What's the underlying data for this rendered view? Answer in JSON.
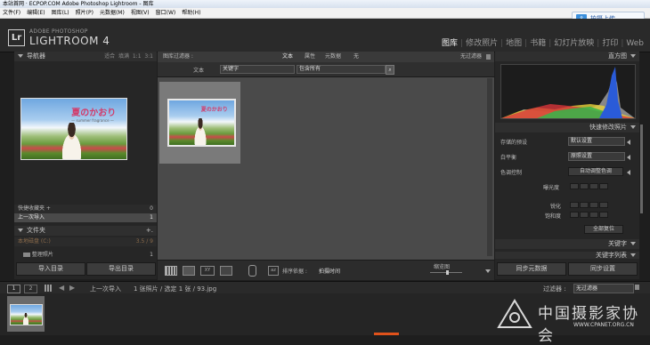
{
  "window": {
    "title_prefix": "本站首网 · ECPOP.COM",
    "title": "Adobe Photoshop Lightroom - 图库"
  },
  "menu": [
    "文件(F)",
    "编辑(E)",
    "图库(L)",
    "照片(P)",
    "元数据(M)",
    "视图(V)",
    "窗口(W)",
    "帮助(H)"
  ],
  "upload_button": {
    "label": "拍摄上传"
  },
  "identity": {
    "logo": "Lr",
    "small": "ADOBE PHOTOSHOP",
    "big": "LIGHTROOM 4"
  },
  "modules": [
    {
      "label": "图库",
      "active": true
    },
    {
      "label": "修改照片",
      "active": false
    },
    {
      "label": "地图",
      "active": false
    },
    {
      "label": "书籍",
      "active": false
    },
    {
      "label": "幻灯片放映",
      "active": false
    },
    {
      "label": "打印",
      "active": false
    },
    {
      "label": "Web",
      "active": false
    }
  ],
  "navigator": {
    "title": "导航器",
    "zoom_options": [
      "适合",
      "填满",
      "1:1",
      "3:1"
    ]
  },
  "photo": {
    "title": "夏のかおり",
    "subtitle": "— summer fragrance —"
  },
  "catalog": {
    "quick_collection": "快捷收藏夹 +",
    "quick_collection_count": "0",
    "previous_import": "上一次导入",
    "previous_import_count": "1"
  },
  "folders": {
    "title": "文件夹",
    "disk_label": "本地磁盘 (C:)",
    "disk_info": "3.5 / 9",
    "folder_name": "整理照片",
    "folder_count": "1"
  },
  "left_buttons": {
    "import": "导入目录",
    "export": "导出目录"
  },
  "library_filter": {
    "title": "图库过滤器 :",
    "tabs": [
      "文本",
      "属性",
      "元数据",
      "无"
    ],
    "preset": "无过滤器"
  },
  "text_filter": {
    "label": "文本",
    "field": "关键字",
    "rule": "包含所有"
  },
  "toolbar": {
    "sort_label": "排序依据 :",
    "sort_value": "拍摄时间",
    "thumb_label": "缩览图"
  },
  "histogram": {
    "title": "直方图"
  },
  "quick_develop": {
    "title": "快速修改照片",
    "preset_label": "存储的预设",
    "preset_value": "默认设置",
    "wb_label": "白平衡",
    "wb_value": "原照设置",
    "tone_label": "色调控制",
    "tone_auto": "自动调整色调",
    "exposure": "曝光度",
    "clarity": "锐化",
    "vibrance": "饱和度",
    "reset": "全部复位"
  },
  "right_sections": {
    "keywording": "关键字",
    "keyword_list": "关键字列表"
  },
  "right_buttons": {
    "sync_meta": "同步元数据",
    "sync_settings": "同步设置"
  },
  "filmbar": {
    "page1": "1",
    "page2": "2",
    "source": "上一次导入",
    "count": "1 张照片 / 选定 1 张 / 93.jpg",
    "filter_label": "过滤器 :",
    "filter_value": "无过滤器"
  },
  "watermark": {
    "main": "中国摄影家协会",
    "sub": "WWW.CPANET.ORG.CN"
  },
  "histogram_colors": {
    "blue": "#2a5bd8",
    "red": "#d8343a",
    "yellow": "#e8d23a",
    "green": "#35b54a",
    "gray": "#9a9a9a"
  }
}
